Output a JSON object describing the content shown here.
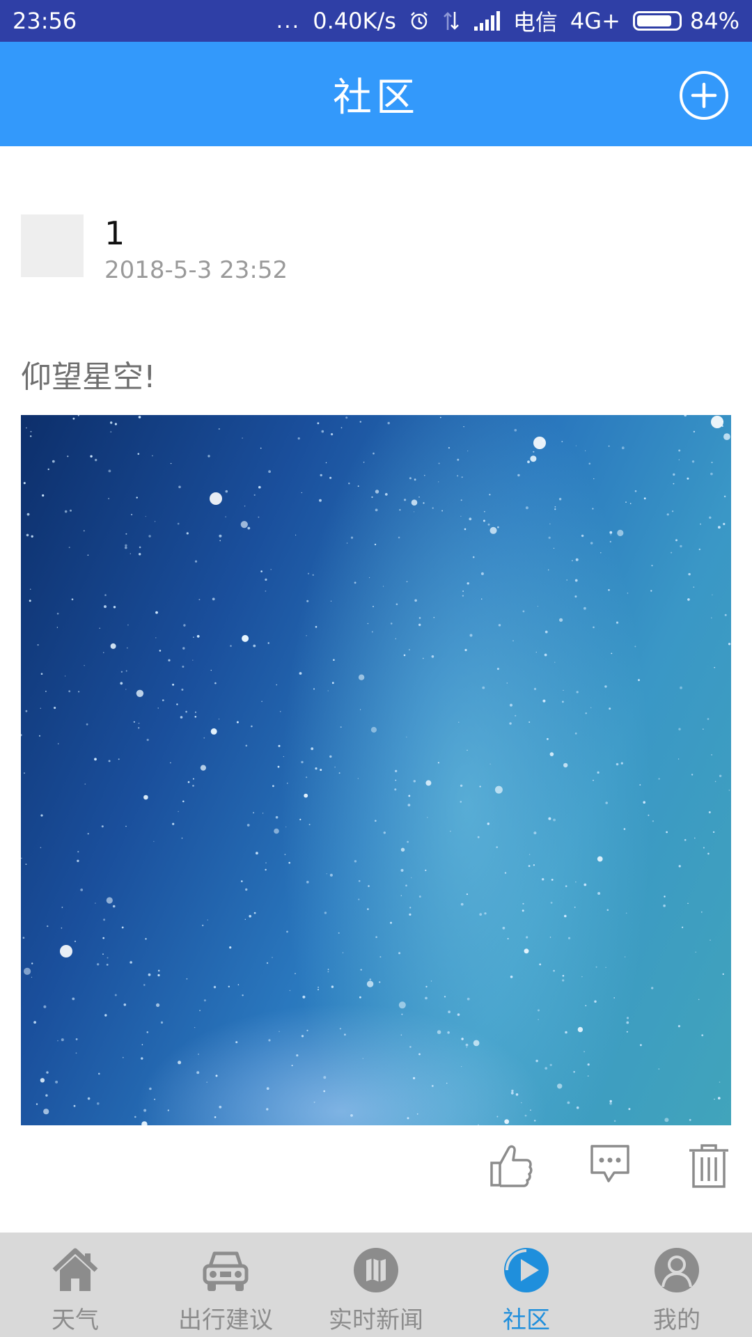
{
  "status_bar": {
    "time": "23:56",
    "dots": "...",
    "speed": "0.40K/s",
    "carrier": "电信",
    "network": "4G+",
    "battery": "84%",
    "battery_level": 0.84,
    "icons": [
      "alarm-icon",
      "data-arrows-icon",
      "signal-icon",
      "battery-icon"
    ]
  },
  "title_bar": {
    "title": "社区",
    "add_icon": "plus-circle-icon"
  },
  "post": {
    "author": "1",
    "time": "2018-5-3 23:52",
    "text": "仰望星空!",
    "image_subject": "starry-sky-photo",
    "actions": [
      "like-icon",
      "comment-icon",
      "delete-icon"
    ]
  },
  "bottom_nav": {
    "active": "社区",
    "items": [
      {
        "label": "天气",
        "icon": "house-icon"
      },
      {
        "label": "出行建议",
        "icon": "car-icon"
      },
      {
        "label": "实时新闻",
        "icon": "map-icon"
      },
      {
        "label": "社区",
        "icon": "community-icon"
      },
      {
        "label": "我的",
        "icon": "user-icon"
      }
    ]
  },
  "colors": {
    "status_bar": "#2f3fa6",
    "title_bar": "#3399fb",
    "nav_bar": "#d9d9d9",
    "nav_active": "#1f8fdc",
    "nav_inactive": "#8c8c8c"
  }
}
